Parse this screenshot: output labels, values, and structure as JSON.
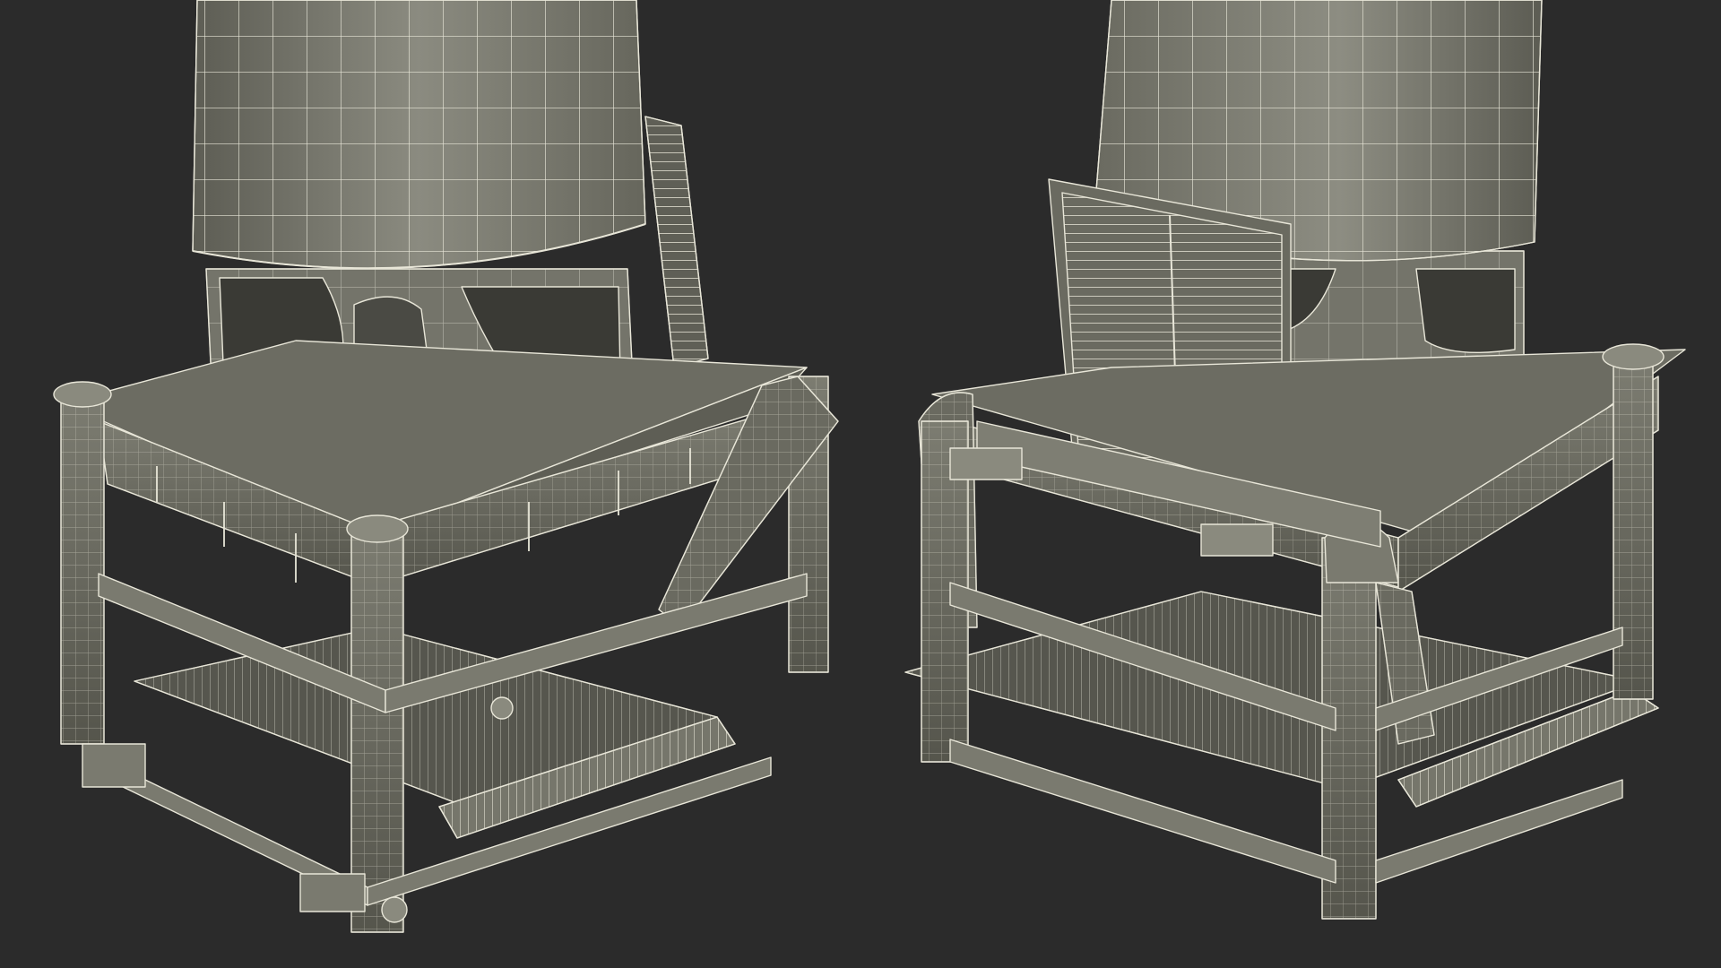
{
  "scene": {
    "background": "#2b2b2b",
    "mesh_fill": "#6f6f64",
    "mesh_fill_light": "#8a8a7e",
    "mesh_fill_dark": "#55554c",
    "wire_color": "#e8e6d8",
    "view_left": "model-view-left",
    "view_right": "model-view-right"
  }
}
